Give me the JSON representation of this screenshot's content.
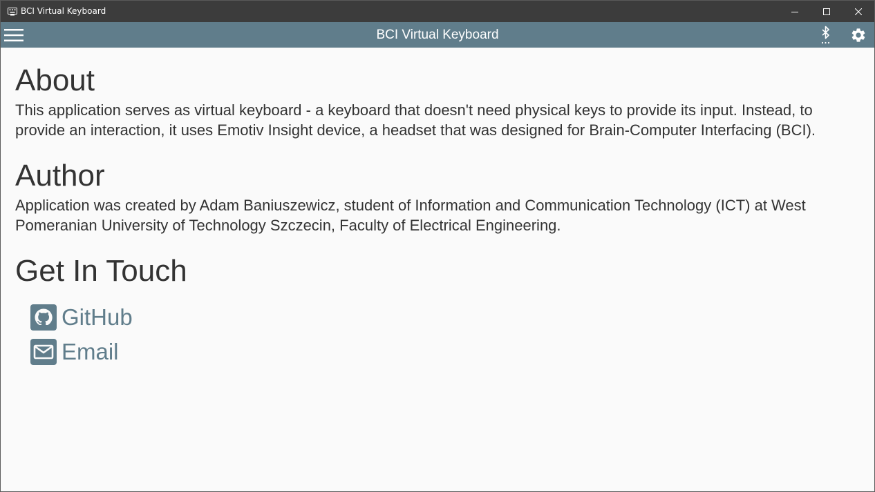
{
  "window": {
    "title": "BCI Virtual Keyboard",
    "icon": "keyboard-icon",
    "controls": [
      "minimize-icon",
      "maximize-icon",
      "close-icon"
    ]
  },
  "appbar": {
    "title": "BCI Virtual Keyboard",
    "menu_icon": "hamburger-menu-icon",
    "bluetooth_icon": "bluetooth-searching-icon",
    "settings_icon": "gear-icon",
    "color": "#607d8b"
  },
  "about": {
    "heading": "About",
    "text": "This application serves as virtual keyboard - a keyboard that doesn't need physical keys to provide its input. Instead, to provide an interaction, it uses Emotiv Insight device, a headset that was designed for Brain-Computer Interfacing (BCI)."
  },
  "author": {
    "heading": "Author",
    "text": "Application was created by Adam Baniuszewicz, student of Information and Communication Technology (ICT) at West Pomeranian University of Technology Szczecin, Faculty of Electrical Engineering."
  },
  "contact": {
    "heading": "Get In Touch",
    "links": [
      {
        "label": "GitHub",
        "icon": "github-icon"
      },
      {
        "label": "Email",
        "icon": "email-icon"
      }
    ]
  },
  "colors": {
    "titlebar": "#3c3c3c",
    "accent": "#607d8b",
    "background": "#fafafa",
    "text": "#333333"
  }
}
